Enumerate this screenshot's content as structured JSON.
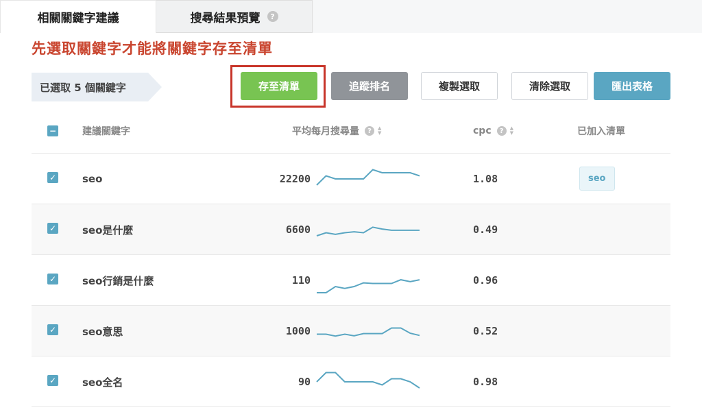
{
  "tabs": [
    {
      "label": "相關關鍵字建議"
    },
    {
      "label": "搜尋結果預覽",
      "help": "?"
    }
  ],
  "warning": "先選取關鍵字才能將關鍵字存至清單",
  "selection": {
    "text": "已選取 5 個關鍵字"
  },
  "buttons": {
    "save": "存至清單",
    "track": "追蹤排名",
    "copy": "複製選取",
    "clear": "清除選取",
    "export": "匯出表格"
  },
  "columns": {
    "select_all": "−",
    "keyword": "建議關鍵字",
    "volume": "平均每月搜尋量",
    "cpc": "cpc",
    "added": "已加入清單",
    "help": "?",
    "sort_up": "▲",
    "sort_down": "▼"
  },
  "colors": {
    "accent": "#5aa6c2",
    "save": "#78c452",
    "warning": "#c9452f"
  },
  "rows": [
    {
      "keyword": "seo",
      "volume": "22200",
      "cpc": "1.08",
      "added": "seo",
      "checked": "✓",
      "trend": [
        2,
        5,
        4,
        4,
        4,
        4,
        7,
        6,
        6,
        6,
        6,
        5
      ]
    },
    {
      "keyword": "seo是什麼",
      "volume": "6600",
      "cpc": "0.49",
      "added": "",
      "checked": "✓",
      "trend": [
        2,
        3,
        2.5,
        3,
        3.3,
        3,
        4.8,
        4.2,
        3.8,
        3.8,
        3.8,
        3.8
      ]
    },
    {
      "keyword": "seo行銷是什麼",
      "volume": "110",
      "cpc": "0.96",
      "added": "",
      "checked": "✓",
      "trend": [
        0,
        0,
        2,
        1.4,
        2,
        3.2,
        3,
        3,
        3,
        4.2,
        3.6,
        4.2
      ]
    },
    {
      "keyword": "seo意思",
      "volume": "1000",
      "cpc": "0.52",
      "added": "",
      "checked": "✓",
      "trend": [
        3,
        3,
        2.4,
        3,
        2.5,
        3.2,
        3.2,
        3.2,
        5,
        5,
        3.3,
        2.6
      ]
    },
    {
      "keyword": "seo全名",
      "volume": "90",
      "cpc": "0.98",
      "added": "",
      "checked": "✓",
      "trend": [
        4,
        7,
        7,
        4,
        4,
        4,
        4,
        3,
        5,
        5,
        4,
        2
      ]
    }
  ]
}
